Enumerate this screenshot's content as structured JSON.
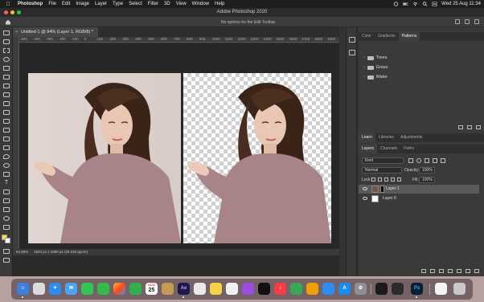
{
  "menubar": {
    "app_name": "Photoshop",
    "items": [
      "File",
      "Edit",
      "Image",
      "Layer",
      "Type",
      "Select",
      "Filter",
      "3D",
      "View",
      "Window",
      "Help"
    ],
    "datetime": "Wed 25 Aug  11:34"
  },
  "window": {
    "title": "Adobe Photoshop 2020"
  },
  "options_bar": {
    "message": "No options for the Edit Toolbar."
  },
  "document": {
    "tab_title": "Untitled-1 @ 94% (Layer 1, RGB/8) *",
    "ruler_ticks": [
      "-500",
      "-400",
      "-300",
      "-200",
      "-100",
      "0",
      "100",
      "200",
      "300",
      "400",
      "500",
      "600",
      "700",
      "800",
      "900",
      "1000",
      "1100",
      "1200",
      "1300",
      "1400",
      "1500",
      "1600",
      "1700",
      "1800",
      "1900"
    ],
    "zoom": "94.05%",
    "size_info": "1920 px x 1080 px (28.346 ppcm)"
  },
  "panels": {
    "top_tabs": [
      {
        "label": "Color",
        "active": false
      },
      {
        "label": "Gradients",
        "active": false
      },
      {
        "label": "Patterns",
        "active": true
      }
    ],
    "pattern_groups": [
      "Trees",
      "Grass",
      "Water"
    ],
    "learn_tabs": [
      {
        "label": "Learn",
        "active": true
      },
      {
        "label": "Libraries",
        "active": false
      },
      {
        "label": "Adjustments",
        "active": false
      }
    ],
    "layers_tabs": [
      {
        "label": "Layers",
        "active": true
      },
      {
        "label": "Channels",
        "active": false
      },
      {
        "label": "Paths",
        "active": false
      }
    ],
    "search_placeholder": "Kind",
    "blend_mode": "Normal",
    "opacity_label": "Opacity:",
    "opacity_value": "100%",
    "lock_label": "Lock:",
    "fill_label": "Fill:",
    "fill_value": "100%",
    "layers": [
      {
        "name": "Layer 1",
        "selected": true,
        "has_mask": true
      },
      {
        "name": "Layer 0",
        "selected": false,
        "has_mask": false
      }
    ]
  },
  "dock": {
    "calendar_month": "AUG",
    "calendar_day": "25",
    "after_effects_label": "Ae",
    "photoshop_label": "Ps"
  },
  "colors": {
    "fg_swatch": "#f2e34a",
    "bg_swatch": "#ffffff",
    "accent": "#4a90d9"
  }
}
